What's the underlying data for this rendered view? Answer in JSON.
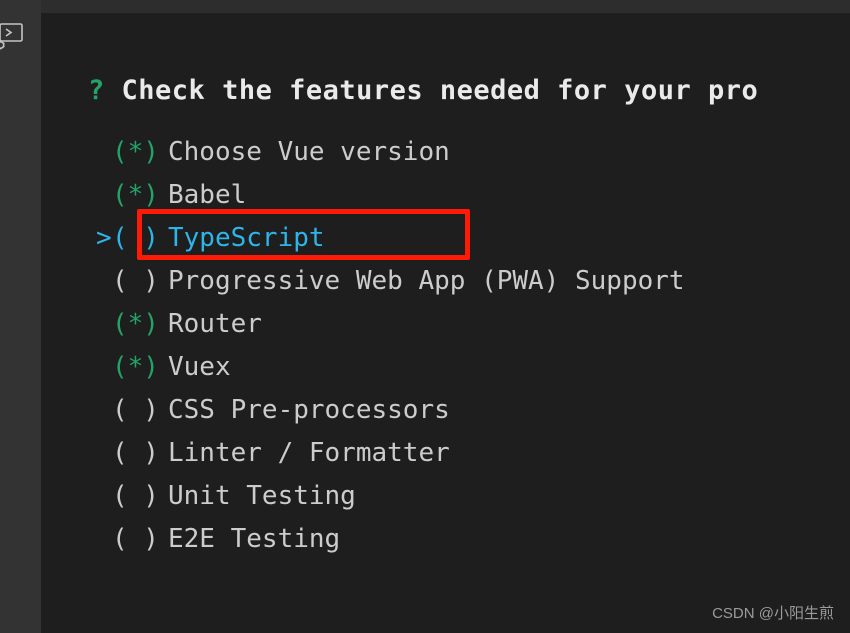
{
  "window": {
    "background_color": "#1e1e1e",
    "activity_bar_color": "#333333",
    "header_strip_color": "#2d2d2d"
  },
  "activity_bar": {
    "icon": "terminal-debug-icon"
  },
  "terminal": {
    "prompt_marker": "?",
    "question": "Check the features needed for your pro",
    "question_full": "Check the features needed for your project",
    "cursor_symbol": ">",
    "checked_marker": "(*)",
    "unchecked_marker": "( )",
    "colors": {
      "selected": "#23a367",
      "highlight": "#2db4e8",
      "text": "#cccccc",
      "question": "#eaeaea",
      "annotation": "#fd1a07"
    },
    "options": [
      {
        "marker": "(*)",
        "label": "Choose Vue version",
        "checked": true,
        "active": false
      },
      {
        "marker": "(*)",
        "label": "Babel",
        "checked": true,
        "active": false
      },
      {
        "marker": "( )",
        "label": "TypeScript",
        "checked": false,
        "active": true
      },
      {
        "marker": "( )",
        "label": "Progressive Web App (PWA) Support",
        "checked": false,
        "active": false
      },
      {
        "marker": "(*)",
        "label": "Router",
        "checked": true,
        "active": false
      },
      {
        "marker": "(*)",
        "label": "Vuex",
        "checked": true,
        "active": false
      },
      {
        "marker": "( )",
        "label": "CSS Pre-processors",
        "checked": false,
        "active": false
      },
      {
        "marker": "( )",
        "label": "Linter / Formatter",
        "checked": false,
        "active": false
      },
      {
        "marker": "( )",
        "label": "Unit Testing",
        "checked": false,
        "active": false
      },
      {
        "marker": "( )",
        "label": "E2E Testing",
        "checked": false,
        "active": false
      }
    ]
  },
  "annotation": {
    "target_label": "TypeScript",
    "color": "#fd1a07"
  },
  "watermark": {
    "text": "CSDN @小阳生煎"
  }
}
